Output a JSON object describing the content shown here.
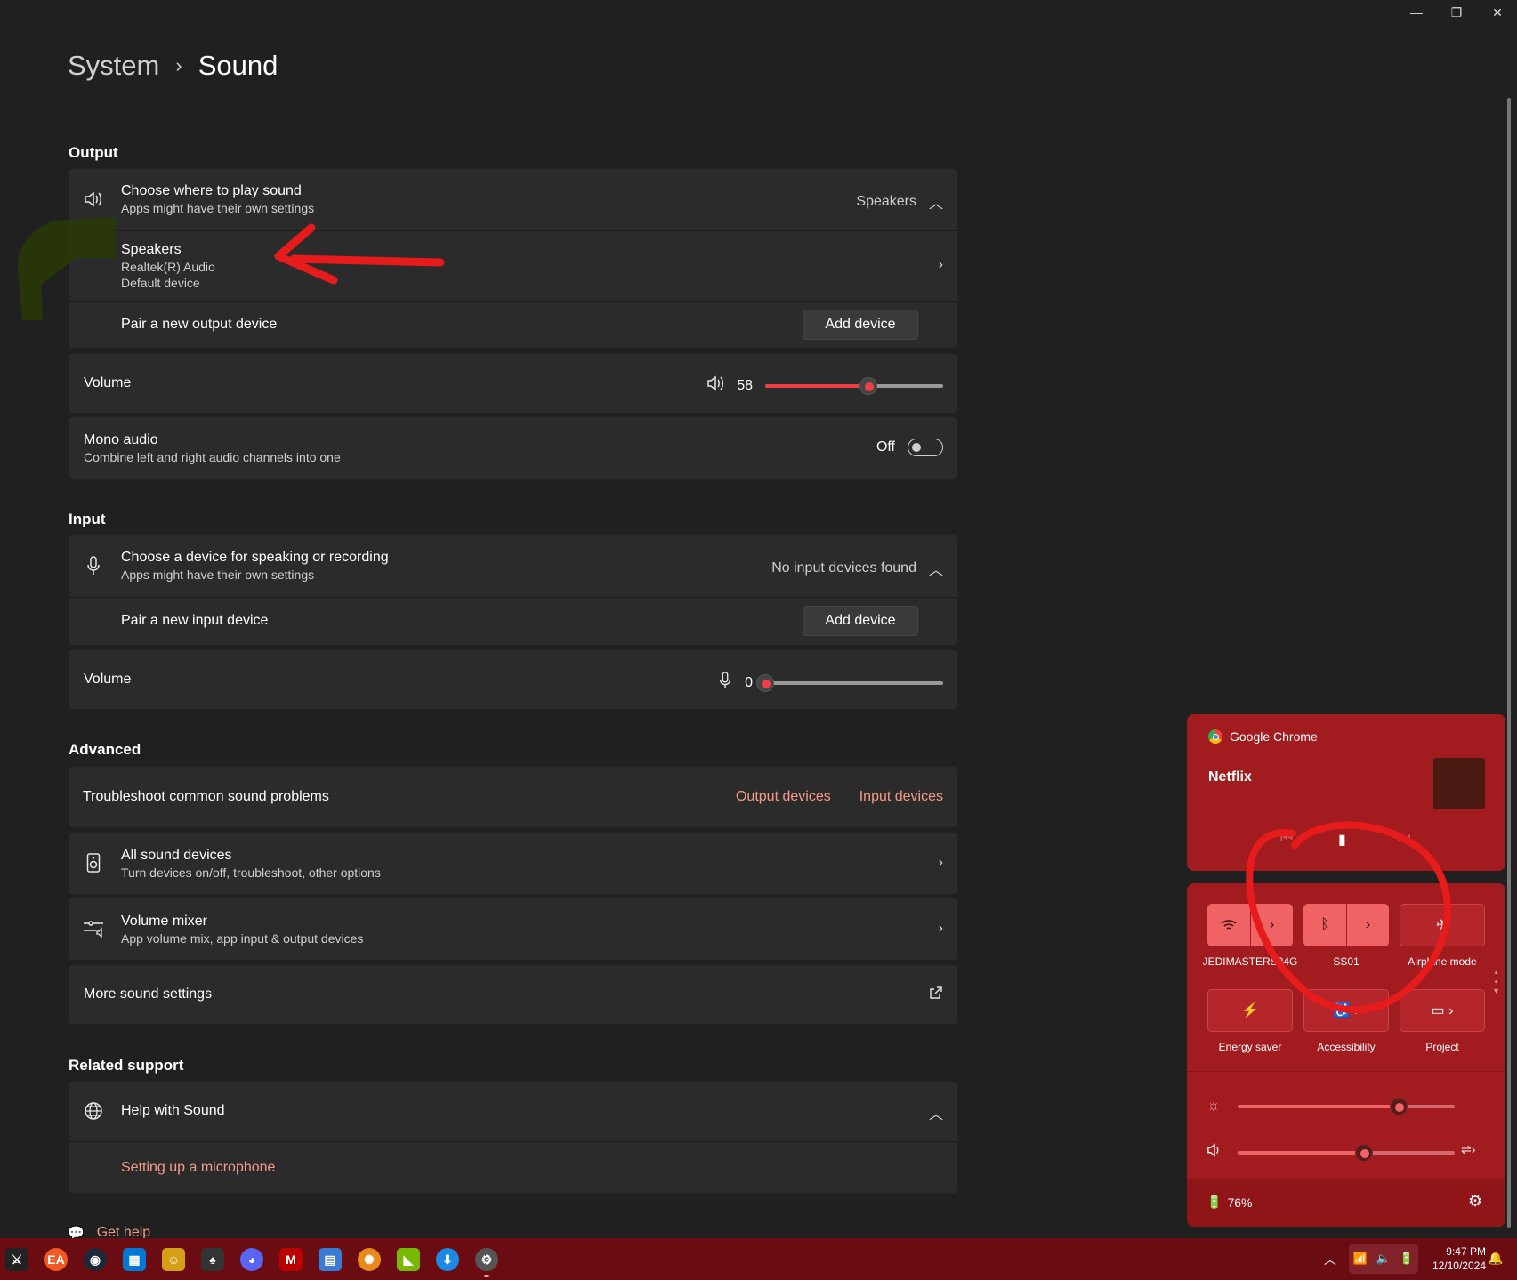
{
  "window_controls": {
    "minimize": "—",
    "maximize": "❐",
    "close": "✕"
  },
  "breadcrumb": {
    "parent": "System",
    "separator": "›",
    "current": "Sound"
  },
  "output": {
    "title": "Output",
    "choose": {
      "title": "Choose where to play sound",
      "subtitle": "Apps might have their own settings",
      "value": "Speakers"
    },
    "device": {
      "name": "Speakers",
      "driver": "Realtek(R) Audio",
      "status": "Default device"
    },
    "pair": {
      "label": "Pair a new output device",
      "button": "Add device"
    },
    "volume": {
      "label": "Volume",
      "value": "58",
      "level": 0.58
    },
    "mono": {
      "title": "Mono audio",
      "subtitle": "Combine left and right audio channels into one",
      "state": "Off"
    }
  },
  "input": {
    "title": "Input",
    "choose": {
      "title": "Choose a device for speaking or recording",
      "subtitle": "Apps might have their own settings",
      "value": "No input devices found"
    },
    "pair": {
      "label": "Pair a new input device",
      "button": "Add device"
    },
    "volume": {
      "label": "Volume",
      "value": "0",
      "level": 0
    }
  },
  "advanced": {
    "title": "Advanced",
    "troubleshoot": {
      "label": "Troubleshoot common sound problems",
      "link1": "Output devices",
      "link2": "Input devices"
    },
    "all_devices": {
      "title": "All sound devices",
      "subtitle": "Turn devices on/off, troubleshoot, other options"
    },
    "mixer": {
      "title": "Volume mixer",
      "subtitle": "App volume mix, app input & output devices"
    },
    "more": {
      "label": "More sound settings"
    }
  },
  "related": {
    "title": "Related support",
    "help": {
      "label": "Help with Sound",
      "link": "Setting up a microphone"
    },
    "get_help": "Get help"
  },
  "media": {
    "app": "Google Chrome",
    "title": "Netflix"
  },
  "quick_settings": {
    "tiles": [
      {
        "label": "JEDIMASTERS24G",
        "icon": "wifi-icon"
      },
      {
        "label": "SS01",
        "icon": "bluetooth-icon"
      },
      {
        "label": "Airplane mode",
        "icon": "airplane-icon"
      },
      {
        "label": "Energy saver",
        "icon": "energy-saver-icon"
      },
      {
        "label": "Accessibility",
        "icon": "accessibility-icon"
      },
      {
        "label": "Project",
        "icon": "project-icon"
      }
    ],
    "brightness_level": 0.74,
    "volume_level": 0.58,
    "battery": "76%"
  },
  "taskbar": {
    "time": "9:47 PM",
    "date": "12/10/2024"
  },
  "colors": {
    "accent": "#ef3e45",
    "link": "#f49a8a",
    "panel": "#a11b1f",
    "taskbar": "#6a0c12"
  }
}
